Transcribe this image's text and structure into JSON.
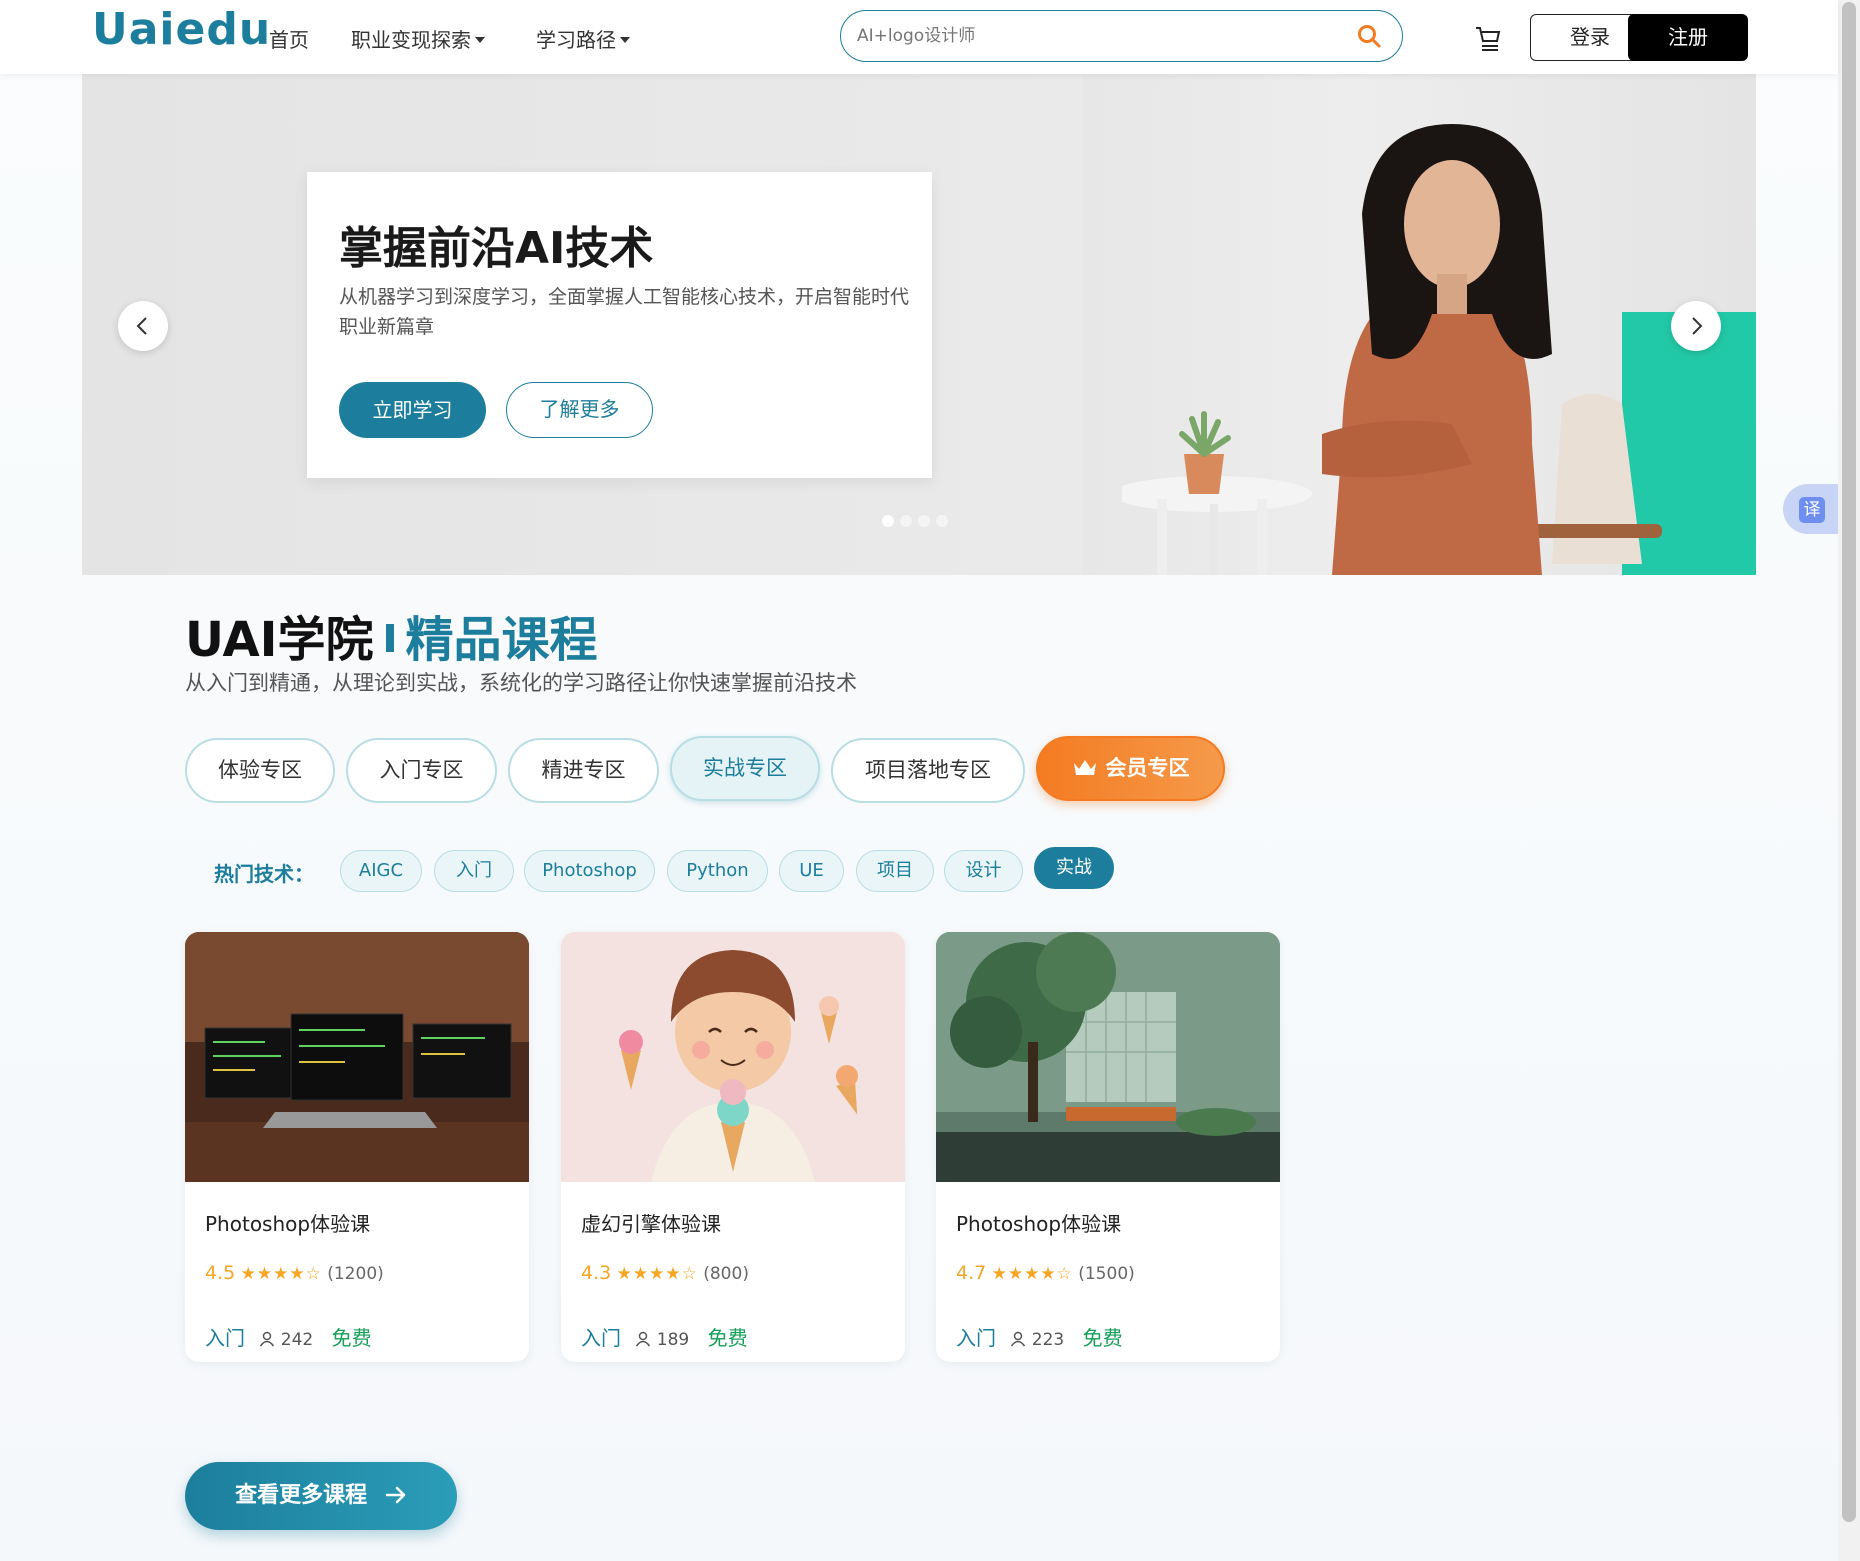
{
  "header": {
    "logo": "Uaiedu",
    "nav": [
      {
        "label": "首页"
      },
      {
        "label": "职业变现探索"
      },
      {
        "label": "学习路径"
      }
    ],
    "search_placeholder": "AI+logo设计师",
    "login_label": "登录",
    "register_label": "注册"
  },
  "hero": {
    "title": "掌握前沿AI技术",
    "description": "从机器学习到深度学习，全面掌握人工智能核心技术，开启智能时代职业新篇章",
    "primary_button": "立即学习",
    "secondary_button": "了解更多",
    "slide_count": 4,
    "active_slide": 1
  },
  "section": {
    "title_main": "UAI学院",
    "title_accent": "精品课程",
    "subtitle": "从入门到精通，从理论到实战，系统化的学习路径让你快速掌握前沿技术",
    "categories": [
      {
        "label": "体验专区"
      },
      {
        "label": "入门专区"
      },
      {
        "label": "精进专区"
      },
      {
        "label": "实战专区"
      },
      {
        "label": "项目落地专区"
      },
      {
        "label": "会员专区"
      }
    ],
    "active_category": "实战专区",
    "hot_label": "热门技术：",
    "tags": [
      {
        "label": "AIGC"
      },
      {
        "label": "入门"
      },
      {
        "label": "Photoshop"
      },
      {
        "label": "Python"
      },
      {
        "label": "UE"
      },
      {
        "label": "项目"
      },
      {
        "label": "设计"
      },
      {
        "label": "实战"
      }
    ],
    "active_tag": "实战"
  },
  "courses": [
    {
      "title": "Photoshop体验课",
      "rating": "4.5",
      "stars": "★★★★☆",
      "reviews": "(1200)",
      "level": "入门",
      "learners": "242",
      "price": "免费"
    },
    {
      "title": "虚幻引擎体验课",
      "rating": "4.3",
      "stars": "★★★★☆",
      "reviews": "(800)",
      "level": "入门",
      "learners": "189",
      "price": "免费"
    },
    {
      "title": "Photoshop体验课",
      "rating": "4.7",
      "stars": "★★★★☆",
      "reviews": "(1500)",
      "level": "入门",
      "learners": "223",
      "price": "免费"
    }
  ],
  "more_button": "查看更多课程",
  "translate_label": "译",
  "colors": {
    "primary": "#1c7e9c",
    "vip": "#f47b22",
    "free": "#16a05a",
    "star": "#f6a623"
  }
}
